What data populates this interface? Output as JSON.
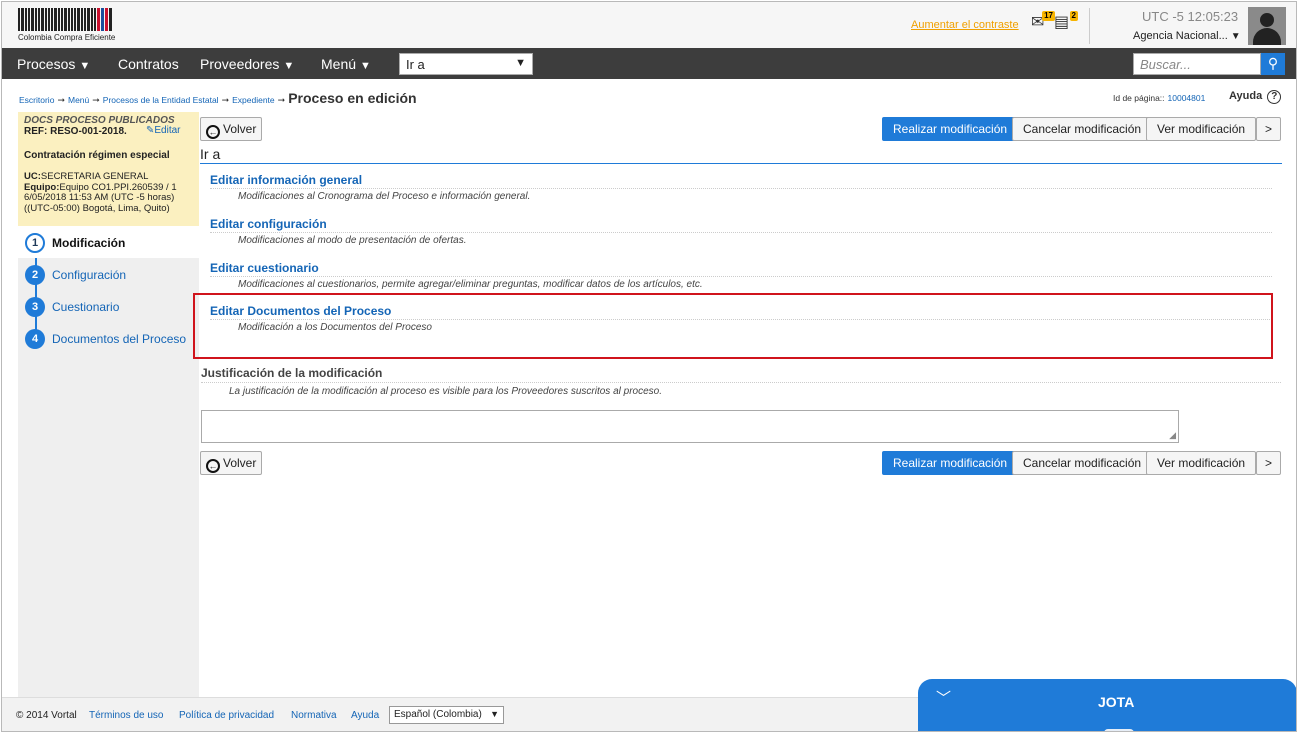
{
  "header": {
    "logo_text": "Colombia Compra Eficiente",
    "contrast_link": "Aumentar el contraste",
    "mail_badge": "17",
    "notes_badge": "2",
    "clock_tz": "UTC -5",
    "clock_time": "12:05:23",
    "agency": "Agencia Nacional..."
  },
  "nav": {
    "items": [
      "Procesos",
      "Contratos",
      "Proveedores",
      "Menú"
    ],
    "goto_value": "Ir a",
    "search_placeholder": "Buscar..."
  },
  "breadcrumb": {
    "items": [
      "Escritorio",
      "Menú",
      "Procesos de la Entidad Estatal",
      "Expediente"
    ],
    "current": "Proceso en edición",
    "page_id_label": "Id de página::",
    "page_id": "10004801",
    "help": "Ayuda"
  },
  "info": {
    "status": "DOCS PROCESO PUBLICADOS",
    "ref": "REF: RESO-001-2018.",
    "edit": "Editar",
    "type": "Contratación régimen especial",
    "uc_label": "UC:",
    "uc_value": "SECRETARIA GENERAL",
    "team_label": "Equipo:",
    "team_value": "Equipo CO1.PPI.260539 / 1",
    "date_line1": "6/05/2018 11:53 AM (UTC -5 horas)",
    "date_line2": "((UTC-05:00) Bogotá, Lima, Quito)"
  },
  "steps": [
    {
      "num": "1",
      "label": "Modificación"
    },
    {
      "num": "2",
      "label": "Configuración"
    },
    {
      "num": "3",
      "label": "Cuestionario"
    },
    {
      "num": "4",
      "label": "Documentos del Proceso"
    }
  ],
  "toolbar": {
    "back": "Volver",
    "apply": "Realizar modificación",
    "cancel": "Cancelar modificación",
    "view": "Ver modificación",
    "next": ">"
  },
  "main": {
    "section_title": "Ir a",
    "options": [
      {
        "title": "Editar información general",
        "desc": "Modificaciones al Cronograma del Proceso e información general."
      },
      {
        "title": "Editar configuración",
        "desc": "Modificaciones al modo de presentación de ofertas."
      },
      {
        "title": "Editar cuestionario",
        "desc": "Modificaciones al cuestionarios, permite agregar/eliminar preguntas, modificar datos de los artículos, etc."
      },
      {
        "title": "Editar Documentos del Proceso",
        "desc": "Modificación a los Documentos del Proceso"
      }
    ],
    "justification_title": "Justificación de la modificación",
    "justification_desc": "La justificación de la modificación al proceso es visible para los Proveedores suscritos al proceso."
  },
  "footer": {
    "copyright": "© 2014 Vortal",
    "links": [
      "Términos de uso",
      "Política de privacidad",
      "Normativa",
      "Ayuda"
    ],
    "language": "Español (Colombia)"
  },
  "chat": {
    "name": "JOTA"
  }
}
